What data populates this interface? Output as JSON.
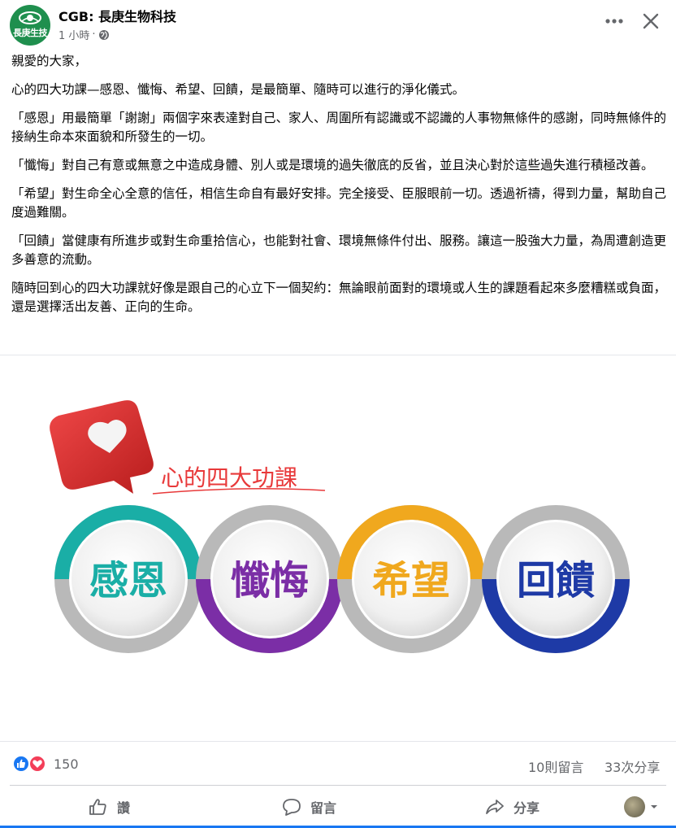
{
  "post": {
    "page_name": "CGB: 長庚生物科技",
    "avatar_text": "長庚生技",
    "time": "1 小時",
    "time_separator": "·",
    "privacy_icon": "globe-icon",
    "menu_icon": "more-horizontal-icon",
    "close_icon": "close-icon"
  },
  "content": {
    "paragraphs": [
      "親愛的大家，",
      "心的四大功課—感恩、懺悔、希望、回饋，是最簡單、隨時可以進行的淨化儀式。",
      "「感恩」用最簡單「謝謝」兩個字來表達對自己、家人、周圍所有認識或不認識的人事物無條件的感謝，同時無條件的接納生命本來面貌和所發生的一切。",
      "「懺悔」對自己有意或無意之中造成身體、別人或是環境的過失徹底的反省，並且決心對於這些過失進行積極改善。",
      "「希望」對生命全心全意的信任，相信生命自有最好安排。完全接受、臣服眼前一切。透過祈禱，得到力量，幫助自己度過難關。",
      "「回饋」當健康有所進步或對生命重拾信心，也能對社會、環境無條件付出、服務。讓這一股強大力量，為周遭創造更多善意的流動。",
      "隨時回到心的四大功課就好像是跟自己的心立下一個契約：無論眼前面對的環境或人生的課題看起來多麼糟糕或負面，還是選擇活出友善、正向的生命。"
    ]
  },
  "graphic": {
    "title": "心的四大功課",
    "icon": "heart-chat-bubble-icon",
    "circles": [
      {
        "label": "感恩",
        "color": "#1aaea6"
      },
      {
        "label": "懺悔",
        "color": "#7b2ea6"
      },
      {
        "label": "希望",
        "color": "#f0a81e"
      },
      {
        "label": "回饋",
        "color": "#1e3aa6"
      }
    ],
    "title_color": "#e8393a"
  },
  "stats": {
    "reactions_count": "150",
    "reaction_icons": [
      "like-icon",
      "love-icon"
    ],
    "comments": "10則留言",
    "shares": "33次分享"
  },
  "actions": {
    "like": "讚",
    "comment": "留言",
    "share": "分享",
    "like_icon": "thumbs-up-icon",
    "comment_icon": "comment-icon",
    "share_icon": "share-icon"
  }
}
